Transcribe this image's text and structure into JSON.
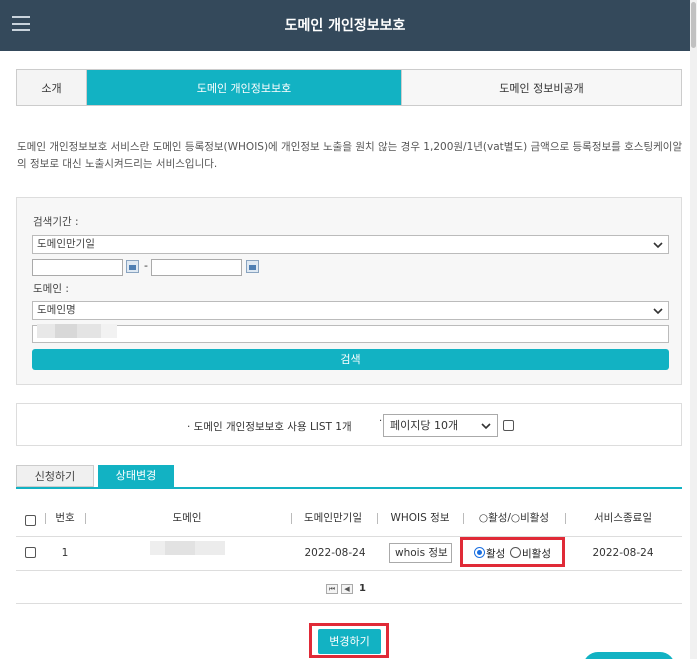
{
  "header": {
    "title": "도메인 개인정보보호"
  },
  "tabs": [
    {
      "label": "소개"
    },
    {
      "label": "도메인 개인정보보호",
      "active": true
    },
    {
      "label": "도메인 정보비공개"
    }
  ],
  "description": "도메인 개인정보보호 서비스란 도메인 등록정보(WHOIS)에 개인정보 노출을 원치 않는 경우 1,200원/1년(vat별도) 금액으로 등록정보를 호스팅케이알의 정보로 대신 노출시켜드리는 서비스입니다.",
  "search": {
    "period_label": "검색기간 :",
    "period_select": "도메인만기일",
    "date_separator": "-",
    "domain_label": "도메인 :",
    "domain_select": "도메인명",
    "button": "검색"
  },
  "list": {
    "title": "· 도메인 개인정보보호 사용 LIST 1개",
    "bullet": "·",
    "page_size": "페이지당 10개"
  },
  "subtabs": [
    {
      "label": "신청하기"
    },
    {
      "label": "상태변경",
      "active": true
    }
  ],
  "table": {
    "headers": [
      "번호",
      "도메인",
      "도메인만기일",
      "WHOIS 정보",
      "○활성/○비활성",
      "서비스종료일"
    ],
    "row": {
      "no": "1",
      "expire": "2022-08-24",
      "whois_button": "whois 정보",
      "radio_active": "활성",
      "radio_inactive": "비활성",
      "end": "2022-08-24"
    }
  },
  "pager": {
    "first": "⏮",
    "prev": "◀",
    "current": "1"
  },
  "change_button": "변경하기",
  "colors": {
    "accent": "#12b2c3",
    "header": "#34495b",
    "highlight": "#e02a37"
  }
}
